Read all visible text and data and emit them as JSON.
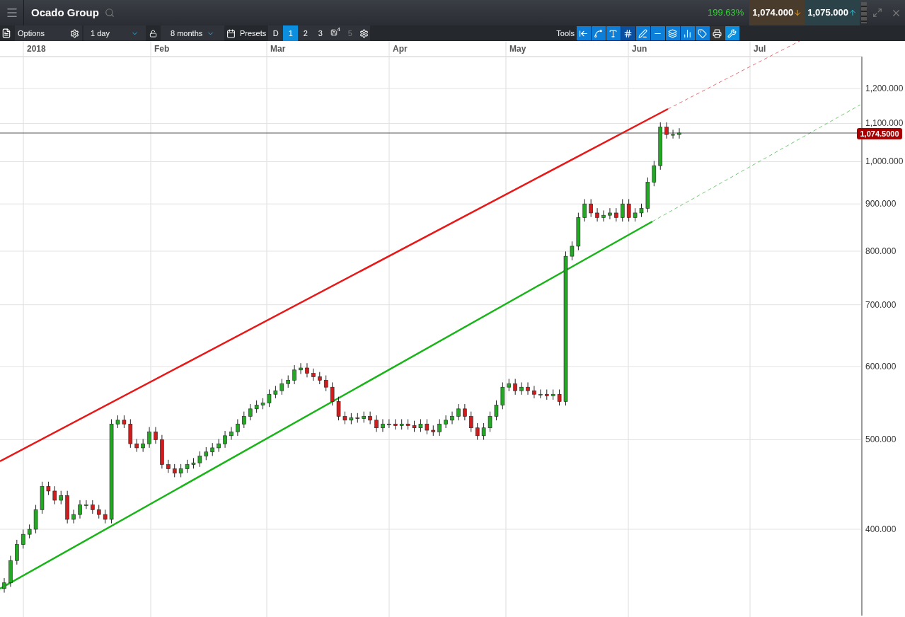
{
  "header": {
    "title": "Ocado Group",
    "change": "199.63%",
    "sell": "1,074.000",
    "buy": "1,075.000"
  },
  "toolbar": {
    "options": "Options",
    "interval": "1 day",
    "range": "8 months",
    "presets_label": "Presets",
    "save_badge": "4",
    "tools_label": "Tools",
    "presets": [
      {
        "label": "D",
        "selected": false,
        "disabled": false
      },
      {
        "label": "1",
        "selected": true,
        "disabled": false
      },
      {
        "label": "2",
        "selected": false,
        "disabled": false
      },
      {
        "label": "3",
        "selected": false,
        "disabled": false
      },
      {
        "label": "5",
        "selected": false,
        "disabled": true
      }
    ]
  },
  "chart": {
    "months": [
      "2018",
      "Feb",
      "Mar",
      "Apr",
      "May",
      "Jun",
      "Jul"
    ],
    "y_ticks": [
      "1,200.000",
      "1,100.000",
      "1,000.000",
      "900.000",
      "800.000",
      "700.000",
      "600.000",
      "500.000",
      "400.000"
    ],
    "price_tag": "1,074.5000"
  }
}
